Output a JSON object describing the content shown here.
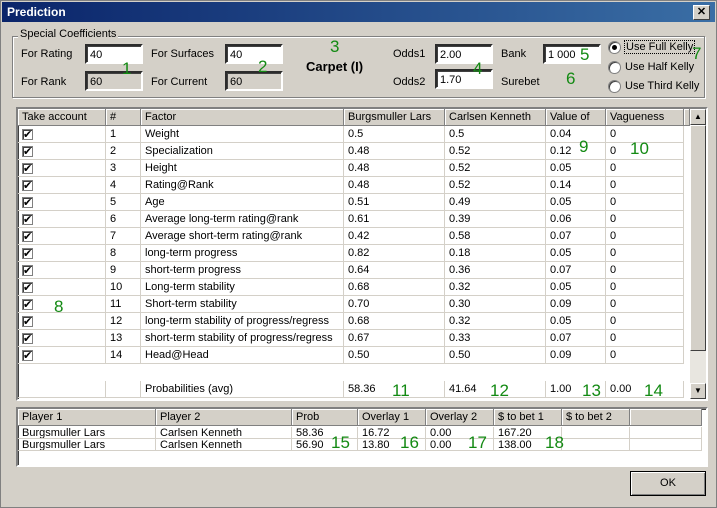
{
  "window": {
    "title": "Prediction",
    "close_label": "✕"
  },
  "special": {
    "legend": "Special Coefficients",
    "for_rating_label": "For Rating",
    "for_rating_value": "40",
    "for_rank_label": "For Rank",
    "for_rank_value": "60",
    "for_surfaces_label": "For Surfaces",
    "for_surfaces_value": "40",
    "for_current_label": "For Current",
    "for_current_value": "60"
  },
  "surface": "Carpet (I)",
  "odds": {
    "odds1_label": "Odds1",
    "odds1_value": "2.00",
    "odds2_label": "Odds2",
    "odds2_value": "1.70"
  },
  "bank": {
    "label": "Bank",
    "value": "1 000",
    "surebet_label": "Surebet"
  },
  "kelly": {
    "options": [
      "Use Full Kelly",
      "Use Half Kelly",
      "Use Third Kelly"
    ],
    "selected": "Use Full Kelly"
  },
  "markers": [
    "1",
    "2",
    "3",
    "4",
    "5",
    "6",
    "7",
    "8",
    "9",
    "10",
    "11",
    "12",
    "13",
    "14",
    "15",
    "16",
    "17",
    "18"
  ],
  "factors_table": {
    "columns": [
      "Take account",
      "#",
      "Factor",
      "Burgsmuller Lars",
      "Carlsen Kenneth",
      "Value of",
      "Vagueness"
    ],
    "rows": [
      {
        "checked": true,
        "n": "1",
        "factor": "Weight",
        "p1": "0.5",
        "p2": "0.5",
        "value": "0.04",
        "vague": "0"
      },
      {
        "checked": true,
        "n": "2",
        "factor": "Specialization",
        "p1": "0.48",
        "p2": "0.52",
        "value": "0.12",
        "vague": "0"
      },
      {
        "checked": true,
        "n": "3",
        "factor": "Height",
        "p1": "0.48",
        "p2": "0.52",
        "value": "0.05",
        "vague": "0"
      },
      {
        "checked": true,
        "n": "4",
        "factor": "Rating@Rank",
        "p1": "0.48",
        "p2": "0.52",
        "value": "0.14",
        "vague": "0"
      },
      {
        "checked": true,
        "n": "5",
        "factor": "Age",
        "p1": "0.51",
        "p2": "0.49",
        "value": "0.05",
        "vague": "0"
      },
      {
        "checked": true,
        "n": "6",
        "factor": "Average long-term rating@rank",
        "p1": "0.61",
        "p2": "0.39",
        "value": "0.06",
        "vague": "0"
      },
      {
        "checked": true,
        "n": "7",
        "factor": "Average short-term rating@rank",
        "p1": "0.42",
        "p2": "0.58",
        "value": "0.07",
        "vague": "0"
      },
      {
        "checked": true,
        "n": "8",
        "factor": "long-term progress",
        "p1": "0.82",
        "p2": "0.18",
        "value": "0.05",
        "vague": "0"
      },
      {
        "checked": true,
        "n": "9",
        "factor": "short-term progress",
        "p1": "0.64",
        "p2": "0.36",
        "value": "0.07",
        "vague": "0"
      },
      {
        "checked": true,
        "n": "10",
        "factor": "Long-term stability",
        "p1": "0.68",
        "p2": "0.32",
        "value": "0.05",
        "vague": "0"
      },
      {
        "checked": true,
        "n": "11",
        "factor": "Short-term stability",
        "p1": "0.70",
        "p2": "0.30",
        "value": "0.09",
        "vague": "0"
      },
      {
        "checked": true,
        "n": "12",
        "factor": "long-term stability of progress/regress",
        "p1": "0.68",
        "p2": "0.32",
        "value": "0.05",
        "vague": "0"
      },
      {
        "checked": true,
        "n": "13",
        "factor": "short-term stability of progress/regress",
        "p1": "0.67",
        "p2": "0.33",
        "value": "0.07",
        "vague": "0"
      },
      {
        "checked": true,
        "n": "14",
        "factor": "Head@Head",
        "p1": "0.50",
        "p2": "0.50",
        "value": "0.09",
        "vague": "0"
      }
    ],
    "summary": {
      "factor": "Probabilities (avg)",
      "p1": "58.36",
      "p2": "41.64",
      "value": "1.00",
      "vague": "0.00"
    }
  },
  "bets_table": {
    "columns": [
      "Player 1",
      "Player 2",
      "Prob",
      "Overlay 1",
      "Overlay 2",
      "$ to bet 1",
      "$ to bet 2"
    ],
    "rows": [
      {
        "p1": "Burgsmuller Lars",
        "p2": "Carlsen Kenneth",
        "prob": "58.36",
        "ov1": "16.72",
        "ov2": "0.00",
        "bet1": "167.20",
        "bet2": ""
      },
      {
        "p1": "Burgsmuller Lars",
        "p2": "Carlsen Kenneth",
        "prob": "56.90",
        "ov1": "13.80",
        "ov2": "0.00",
        "bet1": "138.00",
        "bet2": ""
      }
    ]
  },
  "ok_label": "OK"
}
